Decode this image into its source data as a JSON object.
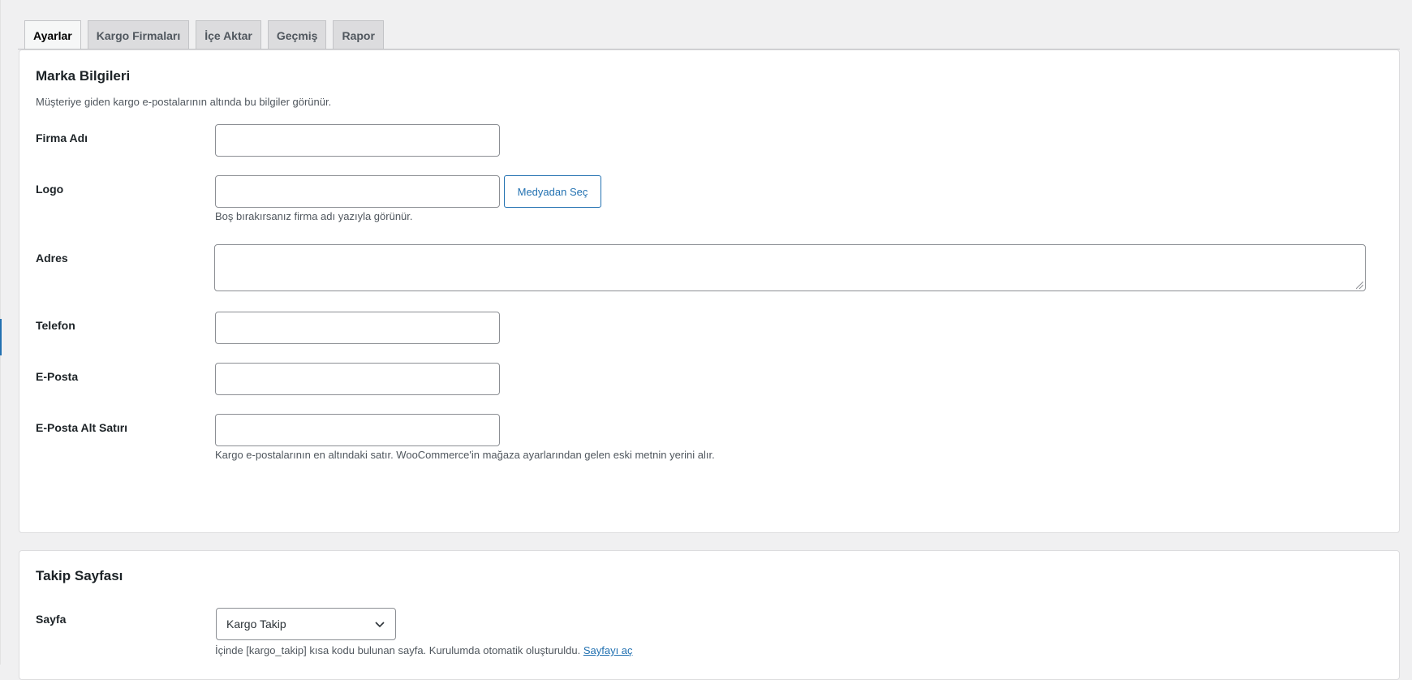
{
  "tabs": [
    {
      "label": "Ayarlar"
    },
    {
      "label": "Kargo Firmaları"
    },
    {
      "label": "İçe Aktar"
    },
    {
      "label": "Geçmiş"
    },
    {
      "label": "Rapor"
    }
  ],
  "brand": {
    "title": "Marka Bilgileri",
    "description": "Müşteriye giden kargo e-postalarının altında bu bilgiler görünür.",
    "company_label": "Firma Adı",
    "company_value": "",
    "logo_label": "Logo",
    "logo_value": "",
    "logo_button": "Medyadan Seç",
    "logo_help": "Boş bırakırsanız firma adı yazıyla görünür.",
    "address_label": "Adres",
    "address_value": "",
    "phone_label": "Telefon",
    "phone_value": "",
    "email_label": "E-Posta",
    "email_value": "",
    "footer_label": "E-Posta Alt Satırı",
    "footer_value": "",
    "footer_help": "Kargo e-postalarının en altındaki satır. WooCommerce'in mağaza ayarlarından gelen eski metnin yerini alır."
  },
  "tracking": {
    "title": "Takip Sayfası",
    "page_label": "Sayfa",
    "page_selected": "Kargo Takip",
    "help_text": "İçinde [kargo_takip] kısa kodu bulunan sayfa. Kurulumda otomatik oluşturuldu.",
    "help_link": "Sayfayı aç"
  },
  "colors": {
    "accent": "#2271b1",
    "background": "#f0f0f1"
  }
}
